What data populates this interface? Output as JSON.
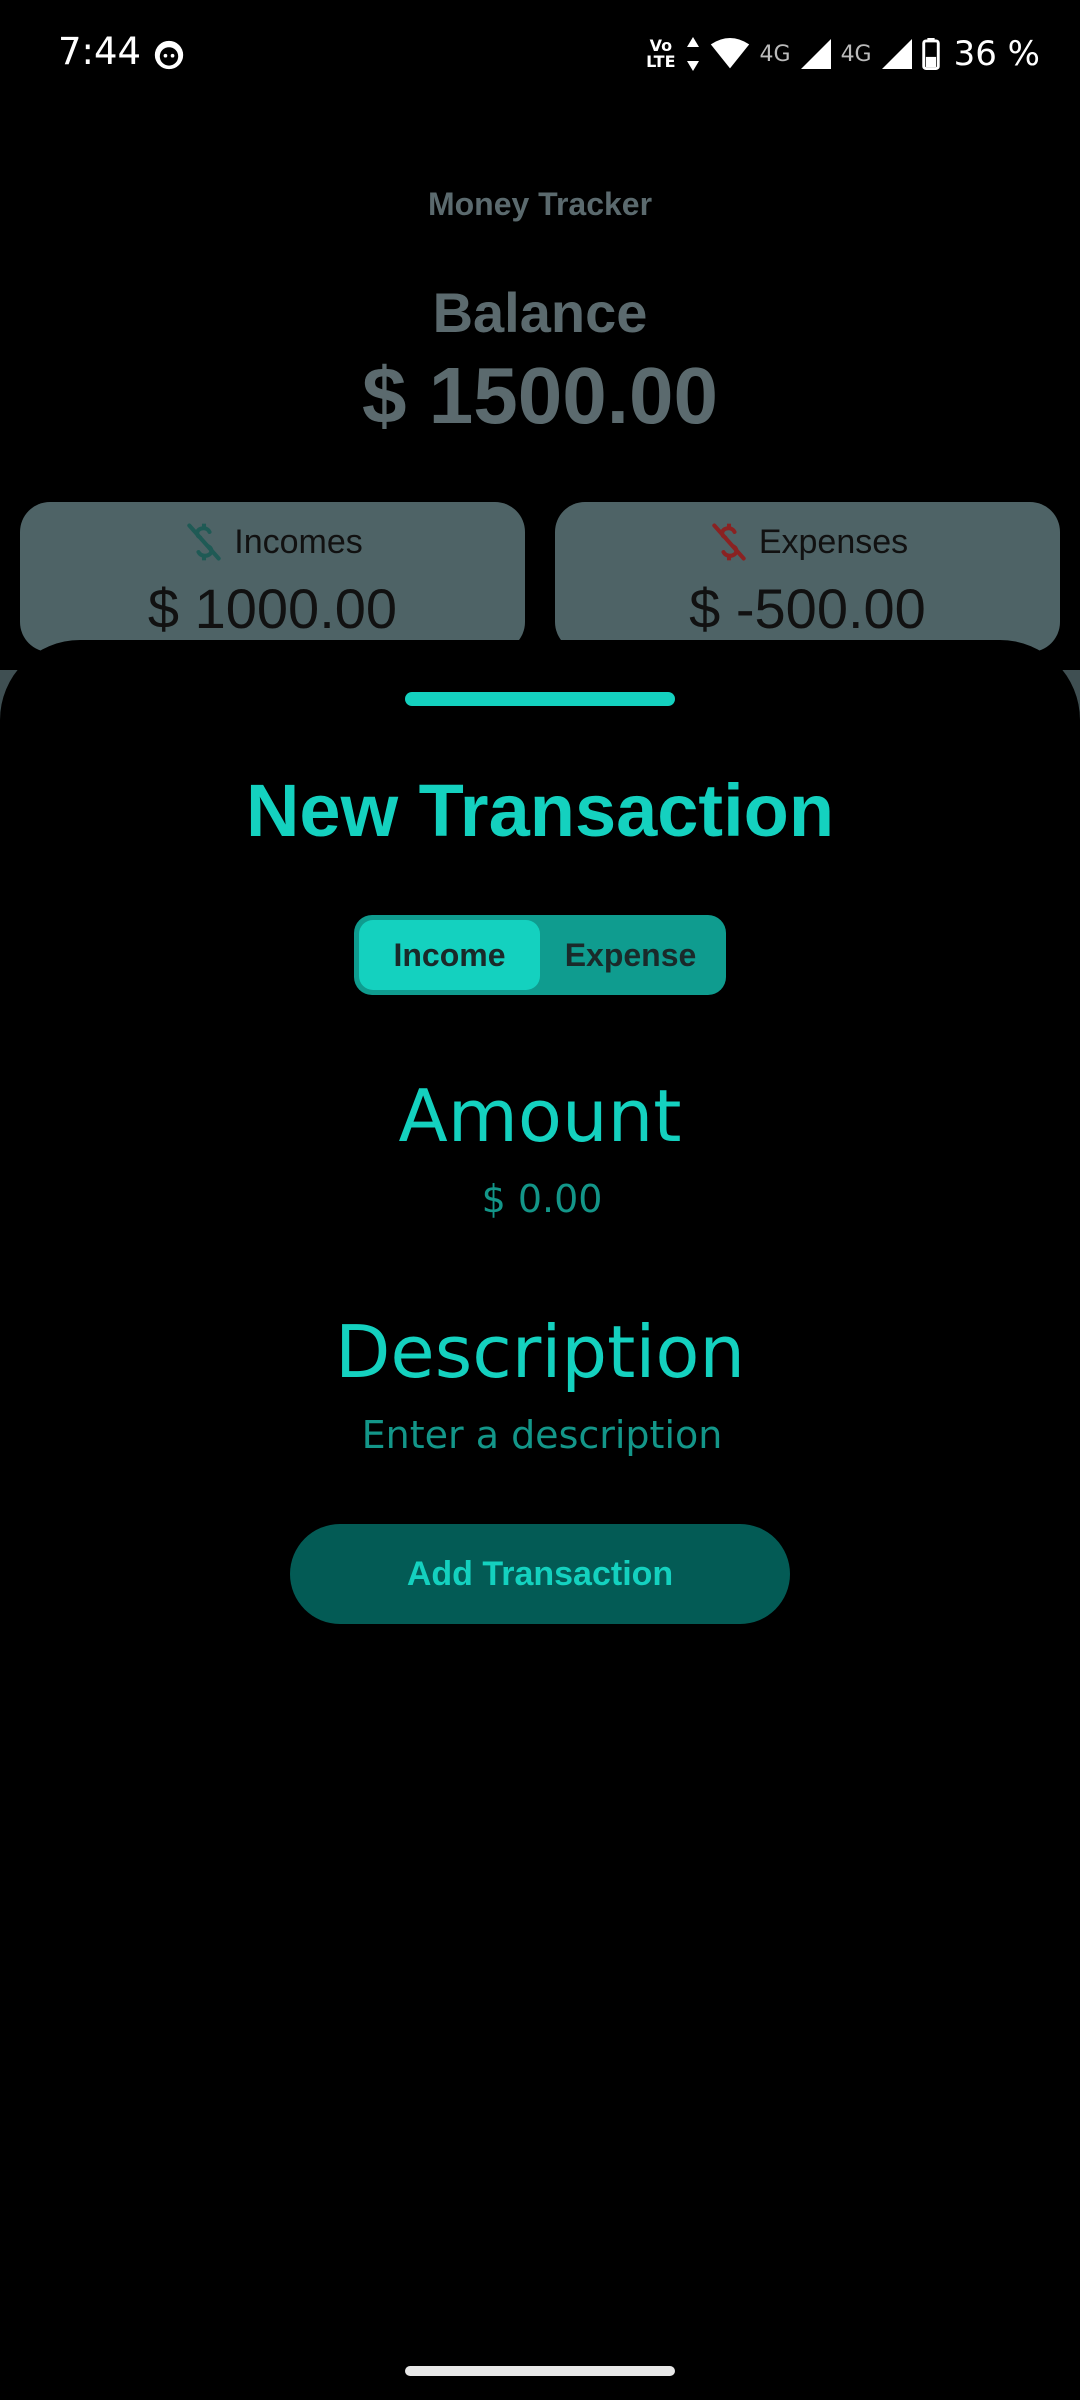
{
  "status_bar": {
    "time": "7:44",
    "volte_top": "Vo",
    "volte_bottom": "LTE",
    "net1": "4G",
    "net2": "4G",
    "battery": "36 %"
  },
  "background": {
    "app_title": "Money Tracker",
    "balance_label": "Balance",
    "balance_value": "$ 1500.00",
    "incomes_label": "Incomes",
    "incomes_value": "$ 1000.00",
    "expenses_label": "Expenses",
    "expenses_value": "$ -500.00"
  },
  "sheet": {
    "title": "New Transaction",
    "toggle": {
      "income": "Income",
      "expense": "Expense",
      "selected": "Income"
    },
    "amount_label": "Amount",
    "amount_placeholder": "$ 0.00",
    "description_label": "Description",
    "description_placeholder": "Enter a description",
    "submit_label": "Add Transaction"
  },
  "colors": {
    "accent": "#14d1bf",
    "accent_dark": "#035b55",
    "dimmed_text": "#5b6a6e",
    "card_bg": "#4e6366",
    "income_icon": "#1f5a55",
    "expense_icon": "#8a2222"
  },
  "icons": {
    "notification": "face-icon",
    "incomes": "money-off-icon",
    "expenses": "money-off-icon"
  }
}
